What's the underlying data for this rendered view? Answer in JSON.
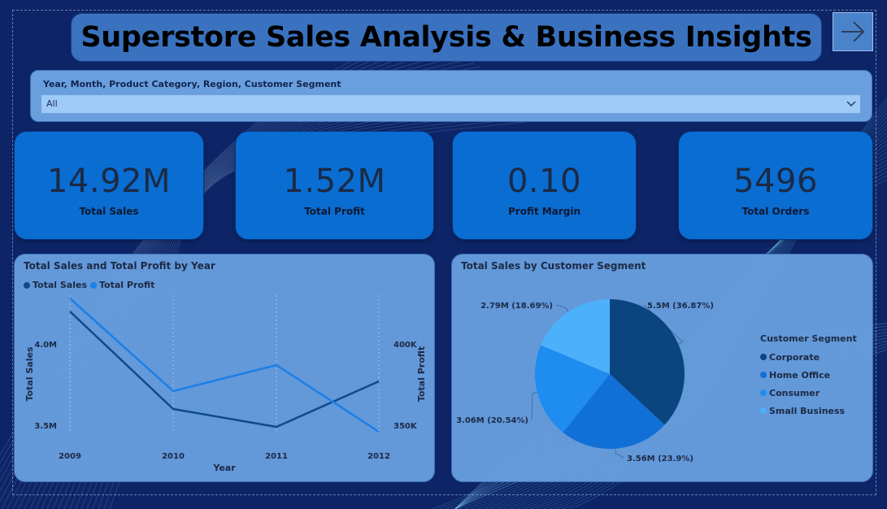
{
  "title": "Superstore Sales Analysis & Business Insights",
  "nav_icon": "arrow-right-icon",
  "slicer": {
    "label": "Year, Month, Product Category, Region, Customer Segment",
    "value": "All",
    "icon": "chevron-down-icon"
  },
  "kpis": [
    {
      "value": "14.92M",
      "label": "Total Sales"
    },
    {
      "value": "1.52M",
      "label": "Total Profit"
    },
    {
      "value": "0.10",
      "label": "Profit Margin"
    },
    {
      "value": "5496",
      "label": "Total Orders"
    }
  ],
  "colors": {
    "sales": "#0e4a8a",
    "profit": "#1a7fe6",
    "corporate": "#0a4580",
    "home_office": "#1170d6",
    "consumer": "#1f8cf0",
    "small_business": "#4db0fb"
  },
  "line_chart": {
    "title": "Total Sales and Total Profit by Year",
    "legend": [
      "Total Sales",
      "Total Profit"
    ],
    "xlabel": "Year",
    "ylabel_left": "Total Sales",
    "ylabel_right": "Total Profit"
  },
  "pie_chart": {
    "title": "Total Sales by Customer Segment",
    "legend_title": "Customer Segment"
  },
  "chart_data": [
    {
      "type": "line",
      "title": "Total Sales and Total Profit by Year",
      "x": [
        "2009",
        "2010",
        "2011",
        "2012"
      ],
      "xlabel": "Year",
      "ylabel": "Total Sales",
      "y2label": "Total Profit",
      "y_ticks": [
        "3.5M",
        "4.0M"
      ],
      "y2_ticks": [
        "350K",
        "400K"
      ],
      "ylim": [
        3.45,
        4.3
      ],
      "y2lim": [
        345,
        430
      ],
      "series": [
        {
          "name": "Total Sales",
          "axis": "left",
          "values": [
            4.2,
            3.6,
            3.49,
            3.77
          ]
        },
        {
          "name": "Total Profit",
          "axis": "right",
          "values": [
            428,
            371,
            387,
            346
          ]
        }
      ]
    },
    {
      "type": "pie",
      "title": "Total Sales by Customer Segment",
      "legend_title": "Customer Segment",
      "slices": [
        {
          "name": "Corporate",
          "value": 36.87,
          "label": "5.5M (36.87%)"
        },
        {
          "name": "Home Office",
          "value": 23.9,
          "label": "3.56M (23.9%)"
        },
        {
          "name": "Consumer",
          "value": 20.54,
          "label": "3.06M (20.54%)"
        },
        {
          "name": "Small Business",
          "value": 18.69,
          "label": "2.79M (18.69%)"
        }
      ]
    }
  ]
}
